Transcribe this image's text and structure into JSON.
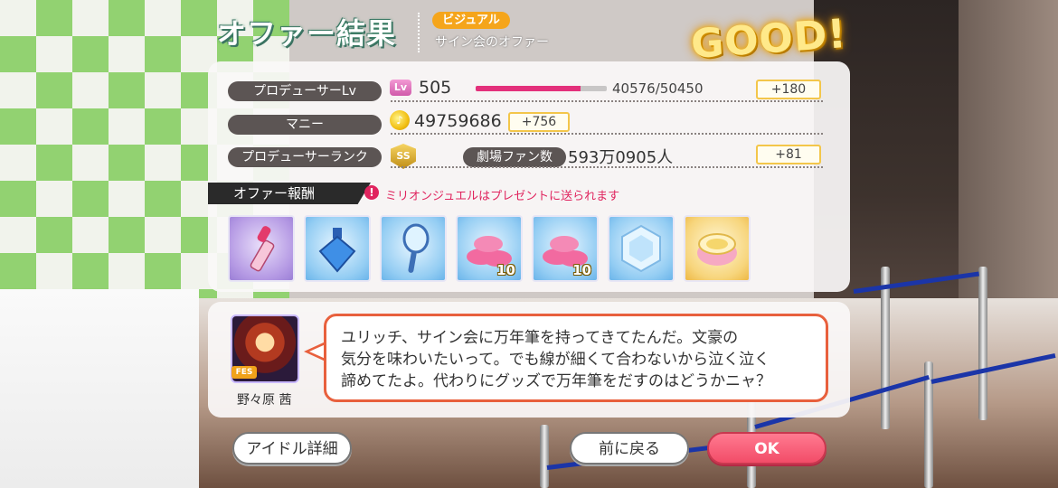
{
  "header": {
    "title": "オファー結果",
    "category_badge": "ビジュアル",
    "offer_name": "サイン会のオファー",
    "result_label": "GOOD!"
  },
  "stats": {
    "producer_lv": {
      "label": "プロデューサーLv",
      "icon_label": "Lv",
      "value": "505",
      "exp": "40576/50450",
      "progress_fraction": 0.8,
      "gain": "+180"
    },
    "money": {
      "label": "マニー",
      "value": "49759686",
      "gain": "+756"
    },
    "producer_rank": {
      "label": "プロデューサーランク",
      "rank_icon_text": "SS",
      "fans_label": "劇場ファン数",
      "fans_value": "593万0905人",
      "fans_gain": "+81"
    }
  },
  "rewards": {
    "title": "オファー報酬",
    "notice": "ミリオンジュエルはプレゼントに送られます",
    "items": [
      {
        "name": "lipstick-icon",
        "count": ""
      },
      {
        "name": "perfume-bottle-icon",
        "count": ""
      },
      {
        "name": "hand-mirror-icon",
        "count": ""
      },
      {
        "name": "macaron-stack-icon",
        "count": "10"
      },
      {
        "name": "macaron-stack-icon",
        "count": "10"
      },
      {
        "name": "crystal-gem-icon",
        "count": ""
      },
      {
        "name": "cosmetic-compact-icon",
        "count": ""
      }
    ]
  },
  "dialogue": {
    "character_name": "野々原 茜",
    "avatar_badge": "FES",
    "lines": [
      "ユリッチ、サイン会に万年筆を持ってきてたんだ。文豪の",
      "気分を味わいたいって。でも線が細くて合わないから泣く泣く",
      "諦めてたよ。代わりにグッズで万年筆をだすのはどうかニャ？"
    ]
  },
  "buttons": {
    "idol_detail": "アイドル詳細",
    "back": "前に戻る",
    "ok": "OK"
  },
  "colors": {
    "accent_pink": "#e3307b",
    "ok_button": "#f24c68",
    "bubble_border": "#e8603d",
    "badge_orange": "#f5a51b"
  }
}
